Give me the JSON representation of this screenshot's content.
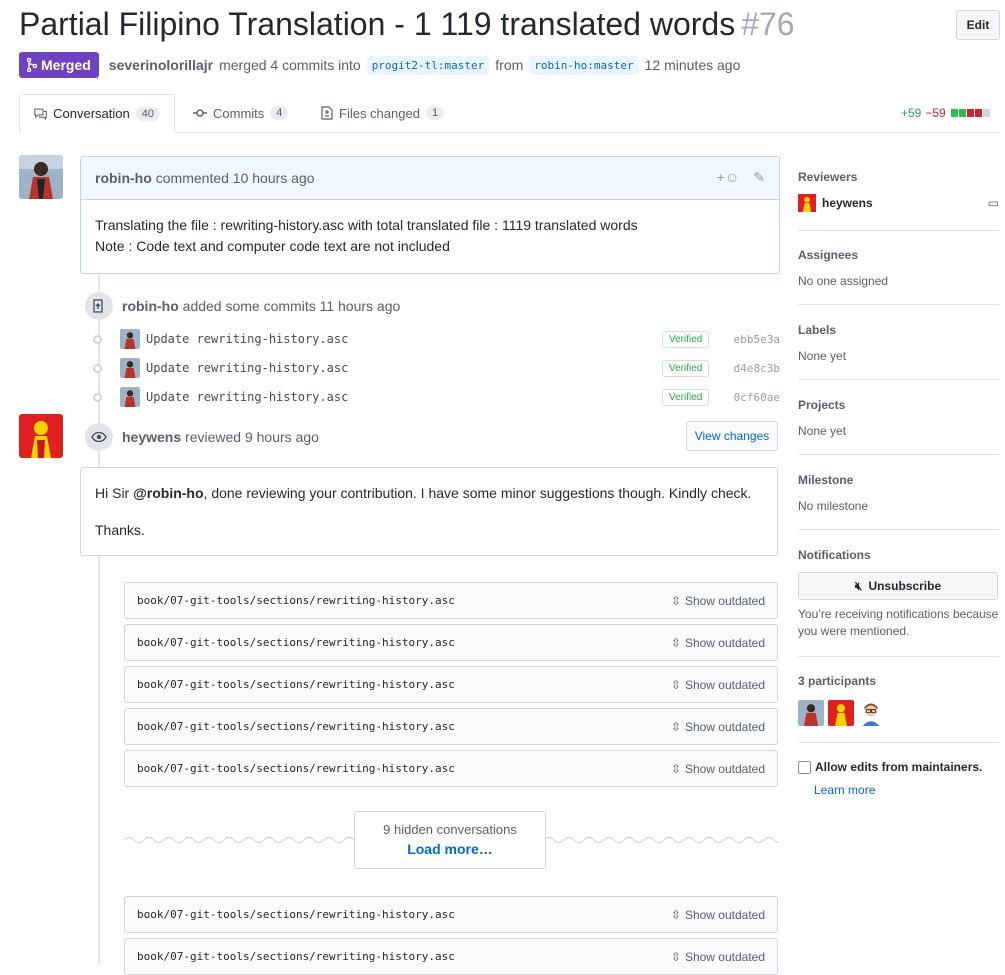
{
  "pr": {
    "title": "Partial Filipino Translation - 1 119 translated words",
    "number": "#76",
    "edit_label": "Edit",
    "status": "Merged",
    "merger": "severinolorillajr",
    "merge_text": "merged 4 commits into",
    "base_branch": "progit2-tl:master",
    "from_text": "from",
    "head_branch": "robin-ho:master",
    "time": "12 minutes ago"
  },
  "tabs": [
    {
      "label": "Conversation",
      "count": "40"
    },
    {
      "label": "Commits",
      "count": "4"
    },
    {
      "label": "Files changed",
      "count": "1"
    }
  ],
  "diffstat": {
    "additions": "+59",
    "deletions": "−59"
  },
  "comment": {
    "author": "robin-ho",
    "action": "commented 10 hours ago",
    "line1": "Translating the file : rewriting-history.asc with total translated file : 1119 translated words",
    "line2": "Note : Code text and computer code text are not included"
  },
  "commits_event": {
    "author": "robin-ho",
    "action": "added some commits 11 hours ago",
    "commits": [
      {
        "message": "Update rewriting-history.asc",
        "verified": "Verified",
        "sha": "ebb5e3a"
      },
      {
        "message": "Update rewriting-history.asc",
        "verified": "Verified",
        "sha": "d4e8c3b"
      },
      {
        "message": "Update rewriting-history.asc",
        "verified": "Verified",
        "sha": "0cf60ae"
      }
    ]
  },
  "review": {
    "author": "heywens",
    "action": "reviewed 9 hours ago",
    "view_changes": "View changes",
    "greeting": "Hi Sir",
    "mention": "@robin-ho",
    "body": ", done reviewing your contribution. I have some minor suggestions though. Kindly check.",
    "thanks": "Thanks."
  },
  "outdated_files": [
    "book/07-git-tools/sections/rewriting-history.asc",
    "book/07-git-tools/sections/rewriting-history.asc",
    "book/07-git-tools/sections/rewriting-history.asc",
    "book/07-git-tools/sections/rewriting-history.asc",
    "book/07-git-tools/sections/rewriting-history.asc",
    "book/07-git-tools/sections/rewriting-history.asc",
    "book/07-git-tools/sections/rewriting-history.asc"
  ],
  "show_outdated_label": "Show outdated",
  "hidden": {
    "count_text": "9 hidden conversations",
    "load_more": "Load more…"
  },
  "sidebar": {
    "reviewers_title": "Reviewers",
    "reviewer": "heywens",
    "assignees_title": "Assignees",
    "assignees_val": "No one assigned",
    "labels_title": "Labels",
    "labels_val": "None yet",
    "projects_title": "Projects",
    "projects_val": "None yet",
    "milestone_title": "Milestone",
    "milestone_val": "No milestone",
    "notifications_title": "Notifications",
    "unsubscribe": "Unsubscribe",
    "notif_note": "You’re receiving notifications because you were mentioned.",
    "participants_title": "3 participants",
    "allow_edits": "Allow edits from maintainers.",
    "learn_more": "Learn more"
  },
  "colors": {
    "merged": "#6f42c1",
    "link": "#0366d6",
    "add": "#28a745",
    "del": "#cb2431"
  }
}
